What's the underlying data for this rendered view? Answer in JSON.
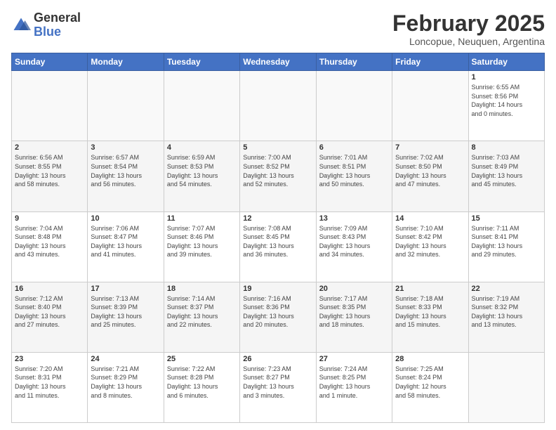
{
  "logo": {
    "general": "General",
    "blue": "Blue"
  },
  "header": {
    "month": "February 2025",
    "location": "Loncopue, Neuquen, Argentina"
  },
  "days_of_week": [
    "Sunday",
    "Monday",
    "Tuesday",
    "Wednesday",
    "Thursday",
    "Friday",
    "Saturday"
  ],
  "weeks": [
    [
      {
        "day": "",
        "info": ""
      },
      {
        "day": "",
        "info": ""
      },
      {
        "day": "",
        "info": ""
      },
      {
        "day": "",
        "info": ""
      },
      {
        "day": "",
        "info": ""
      },
      {
        "day": "",
        "info": ""
      },
      {
        "day": "1",
        "info": "Sunrise: 6:55 AM\nSunset: 8:56 PM\nDaylight: 14 hours\nand 0 minutes."
      }
    ],
    [
      {
        "day": "2",
        "info": "Sunrise: 6:56 AM\nSunset: 8:55 PM\nDaylight: 13 hours\nand 58 minutes."
      },
      {
        "day": "3",
        "info": "Sunrise: 6:57 AM\nSunset: 8:54 PM\nDaylight: 13 hours\nand 56 minutes."
      },
      {
        "day": "4",
        "info": "Sunrise: 6:59 AM\nSunset: 8:53 PM\nDaylight: 13 hours\nand 54 minutes."
      },
      {
        "day": "5",
        "info": "Sunrise: 7:00 AM\nSunset: 8:52 PM\nDaylight: 13 hours\nand 52 minutes."
      },
      {
        "day": "6",
        "info": "Sunrise: 7:01 AM\nSunset: 8:51 PM\nDaylight: 13 hours\nand 50 minutes."
      },
      {
        "day": "7",
        "info": "Sunrise: 7:02 AM\nSunset: 8:50 PM\nDaylight: 13 hours\nand 47 minutes."
      },
      {
        "day": "8",
        "info": "Sunrise: 7:03 AM\nSunset: 8:49 PM\nDaylight: 13 hours\nand 45 minutes."
      }
    ],
    [
      {
        "day": "9",
        "info": "Sunrise: 7:04 AM\nSunset: 8:48 PM\nDaylight: 13 hours\nand 43 minutes."
      },
      {
        "day": "10",
        "info": "Sunrise: 7:06 AM\nSunset: 8:47 PM\nDaylight: 13 hours\nand 41 minutes."
      },
      {
        "day": "11",
        "info": "Sunrise: 7:07 AM\nSunset: 8:46 PM\nDaylight: 13 hours\nand 39 minutes."
      },
      {
        "day": "12",
        "info": "Sunrise: 7:08 AM\nSunset: 8:45 PM\nDaylight: 13 hours\nand 36 minutes."
      },
      {
        "day": "13",
        "info": "Sunrise: 7:09 AM\nSunset: 8:43 PM\nDaylight: 13 hours\nand 34 minutes."
      },
      {
        "day": "14",
        "info": "Sunrise: 7:10 AM\nSunset: 8:42 PM\nDaylight: 13 hours\nand 32 minutes."
      },
      {
        "day": "15",
        "info": "Sunrise: 7:11 AM\nSunset: 8:41 PM\nDaylight: 13 hours\nand 29 minutes."
      }
    ],
    [
      {
        "day": "16",
        "info": "Sunrise: 7:12 AM\nSunset: 8:40 PM\nDaylight: 13 hours\nand 27 minutes."
      },
      {
        "day": "17",
        "info": "Sunrise: 7:13 AM\nSunset: 8:39 PM\nDaylight: 13 hours\nand 25 minutes."
      },
      {
        "day": "18",
        "info": "Sunrise: 7:14 AM\nSunset: 8:37 PM\nDaylight: 13 hours\nand 22 minutes."
      },
      {
        "day": "19",
        "info": "Sunrise: 7:16 AM\nSunset: 8:36 PM\nDaylight: 13 hours\nand 20 minutes."
      },
      {
        "day": "20",
        "info": "Sunrise: 7:17 AM\nSunset: 8:35 PM\nDaylight: 13 hours\nand 18 minutes."
      },
      {
        "day": "21",
        "info": "Sunrise: 7:18 AM\nSunset: 8:33 PM\nDaylight: 13 hours\nand 15 minutes."
      },
      {
        "day": "22",
        "info": "Sunrise: 7:19 AM\nSunset: 8:32 PM\nDaylight: 13 hours\nand 13 minutes."
      }
    ],
    [
      {
        "day": "23",
        "info": "Sunrise: 7:20 AM\nSunset: 8:31 PM\nDaylight: 13 hours\nand 11 minutes."
      },
      {
        "day": "24",
        "info": "Sunrise: 7:21 AM\nSunset: 8:29 PM\nDaylight: 13 hours\nand 8 minutes."
      },
      {
        "day": "25",
        "info": "Sunrise: 7:22 AM\nSunset: 8:28 PM\nDaylight: 13 hours\nand 6 minutes."
      },
      {
        "day": "26",
        "info": "Sunrise: 7:23 AM\nSunset: 8:27 PM\nDaylight: 13 hours\nand 3 minutes."
      },
      {
        "day": "27",
        "info": "Sunrise: 7:24 AM\nSunset: 8:25 PM\nDaylight: 13 hours\nand 1 minute."
      },
      {
        "day": "28",
        "info": "Sunrise: 7:25 AM\nSunset: 8:24 PM\nDaylight: 12 hours\nand 58 minutes."
      },
      {
        "day": "",
        "info": ""
      }
    ]
  ]
}
